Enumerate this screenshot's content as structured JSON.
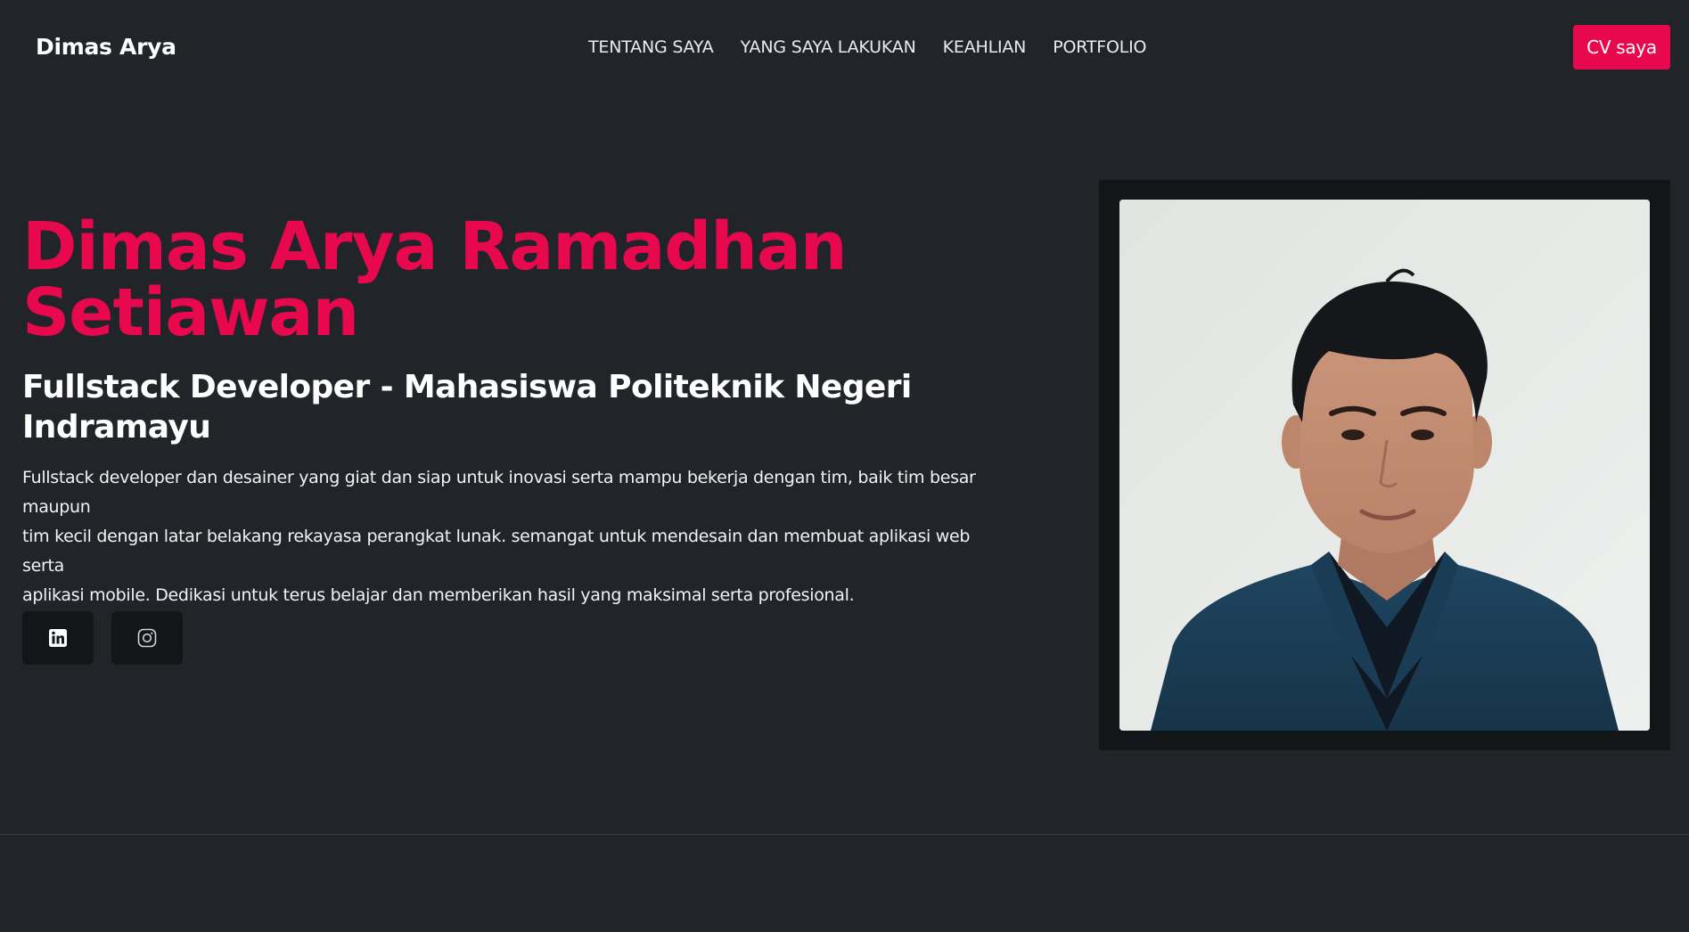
{
  "navbar": {
    "brand": "Dimas Arya",
    "links": [
      "TENTANG SAYA",
      "YANG SAYA LAKUKAN",
      "KEAHLIAN",
      "PORTFOLIO"
    ],
    "cv_button": "CV saya"
  },
  "hero": {
    "name_line1": "Dimas Arya Ramadhan",
    "name_line2": "Setiawan",
    "subtitle_line1": "Fullstack Developer - Mahasiswa Politeknik Negeri",
    "subtitle_line2": "Indramayu",
    "description_line1": "Fullstack developer dan desainer yang giat dan siap untuk inovasi serta mampu bekerja dengan tim, baik tim besar maupun",
    "description_line2": "tim kecil dengan latar belakang rekayasa perangkat lunak. semangat untuk mendesain dan membuat aplikasi web serta",
    "description_line3": "aplikasi mobile. Dedikasi untuk terus belajar dan memberikan hasil yang maksimal serta profesional."
  },
  "social": {
    "items": [
      "linkedin-icon",
      "instagram-icon"
    ]
  },
  "colors": {
    "background": "#212529",
    "accent": "#e8084d",
    "button_dark": "#131619"
  }
}
